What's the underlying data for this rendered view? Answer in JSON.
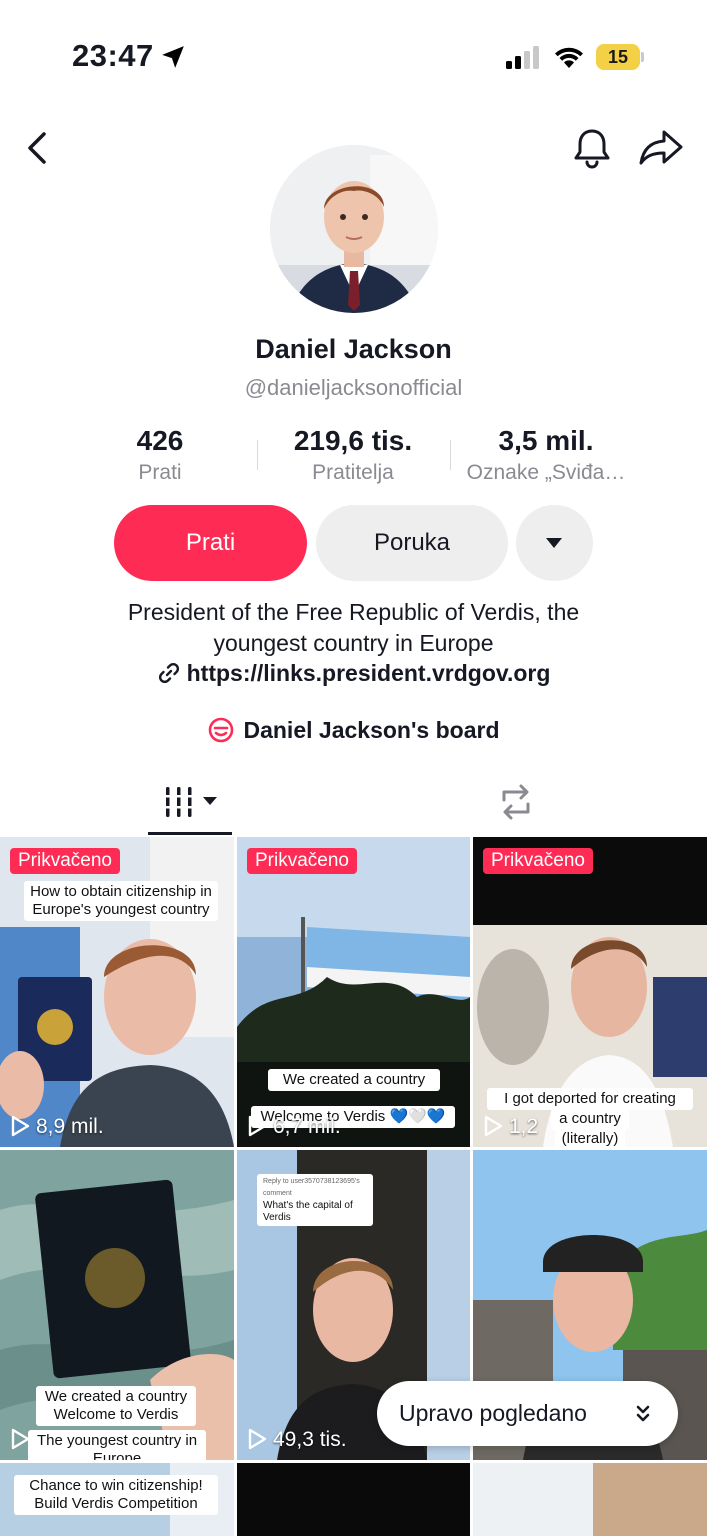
{
  "status": {
    "time": "23:47",
    "battery": "15"
  },
  "profile": {
    "name": "Daniel Jackson",
    "handle": "@danieljacksonofficial",
    "stats": [
      {
        "value": "426",
        "label": "Prati"
      },
      {
        "value": "219,6 tis.",
        "label": "Pratitelja"
      },
      {
        "value": "3,5 mil.",
        "label": "Oznake „Sviđa…"
      }
    ],
    "follow_label": "Prati",
    "message_label": "Poruka",
    "bio_line1": "President of the Free Republic of Verdis, the",
    "bio_line2": "youngest country in Europe",
    "link": "https://links.president.vrdgov.org",
    "board": "Daniel Jackson's board"
  },
  "videos": [
    {
      "pinned": "Prikvačeno",
      "views": "8,9 mil.",
      "caption1": "How to obtain citizenship in",
      "caption2": "Europe's youngest country"
    },
    {
      "pinned": "Prikvačeno",
      "views": "6,7 mil.",
      "caption1": "We created a country",
      "caption2": "Welcome to Verdis 💙🤍💙"
    },
    {
      "pinned": "Prikvačeno",
      "views": "1,2",
      "caption1": "I got deported for creating",
      "caption2": "a country",
      "caption3": "(literally)"
    },
    {
      "views": "",
      "caption1": "We created a country",
      "caption2": "Welcome to Verdis",
      "caption3": "The youngest country in",
      "caption4": "Europe"
    },
    {
      "views": "49,3 tis.",
      "reply1": "Reply to user3570738123695's comment",
      "reply2": "What's the capital of Verdis"
    },
    {
      "views": ""
    },
    {
      "caption1": "Chance to win citizenship!",
      "caption2": "Build Verdis Competition"
    },
    {},
    {}
  ],
  "recently_watched": "Upravo pogledano"
}
